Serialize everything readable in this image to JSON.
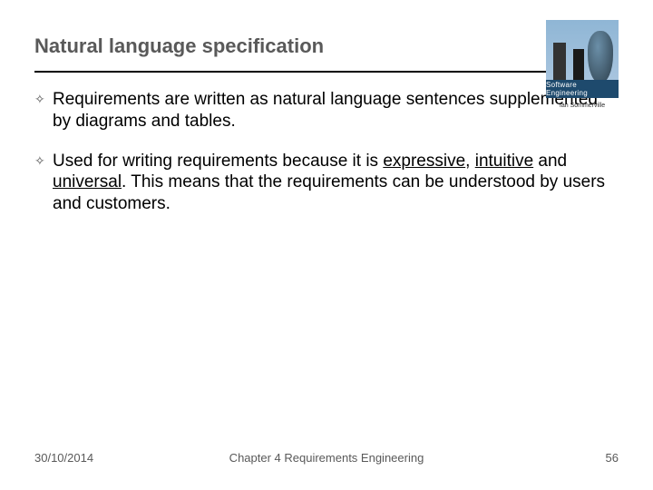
{
  "title": "Natural language specification",
  "logo": {
    "label": "Software Engineering",
    "sub": "Ian Sommerville"
  },
  "bullets": [
    {
      "pre": "Requirements are written as natural language sentences supplemented by diagrams and tables.",
      "u1": "",
      "mid1": "",
      "u2": "",
      "mid2": "",
      "u3": "",
      "post": ""
    },
    {
      "pre": "Used for writing requirements because it is ",
      "u1": "expressive",
      "mid1": ", ",
      "u2": "intuitive",
      "mid2": " and ",
      "u3": "universal",
      "post": ". This means that the requirements can be understood by users and customers."
    }
  ],
  "footer": {
    "date": "30/10/2014",
    "chapter": "Chapter 4 Requirements Engineering",
    "page": "56"
  }
}
